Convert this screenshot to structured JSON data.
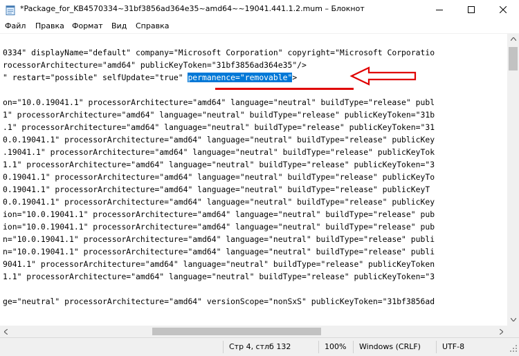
{
  "window": {
    "title": "*Package_for_KB4570334~31bf3856ad364e35~amd64~~19041.441.1.2.mum – Блокнот",
    "minimize_glyph": "—",
    "maximize_glyph": "☐",
    "close_glyph": "✕"
  },
  "menu": {
    "file": "Файл",
    "edit": "Правка",
    "format": "Формат",
    "view": "Вид",
    "help": "Справка"
  },
  "editor": {
    "lines": [
      "0334\" displayName=\"default\" company=\"Microsoft Corporation\" copyright=\"Microsoft Corporatio",
      "rocessorArchitecture=\"amd64\" publicKeyToken=\"31bf3856ad364e35\"/>",
      "",
      "",
      "on=\"10.0.19041.1\" processorArchitecture=\"amd64\" language=\"neutral\" buildType=\"release\" publ",
      "1\" processorArchitecture=\"amd64\" language=\"neutral\" buildType=\"release\" publicKeyToken=\"31b",
      ".1\" processorArchitecture=\"amd64\" language=\"neutral\" buildType=\"release\" publicKeyToken=\"31",
      "0.0.19041.1\" processorArchitecture=\"amd64\" language=\"neutral\" buildType=\"release\" publicKey",
      ".19041.1\" processorArchitecture=\"amd64\" language=\"neutral\" buildType=\"release\" publicKeyTok",
      "1.1\" processorArchitecture=\"amd64\" language=\"neutral\" buildType=\"release\" publicKeyToken=\"3",
      "0.19041.1\" processorArchitecture=\"amd64\" language=\"neutral\" buildType=\"release\" publicKeyTo",
      "0.19041.1\" processorArchitecture=\"amd64\" language=\"neutral\" buildType=\"release\" publicKeyT",
      "0.0.19041.1\" processorArchitecture=\"amd64\" language=\"neutral\" buildType=\"release\" publicKey",
      "ion=\"10.0.19041.1\" processorArchitecture=\"amd64\" language=\"neutral\" buildType=\"release\" pub",
      "ion=\"10.0.19041.1\" processorArchitecture=\"amd64\" language=\"neutral\" buildType=\"release\" pub",
      "n=\"10.0.19041.1\" processorArchitecture=\"amd64\" language=\"neutral\" buildType=\"release\" publi",
      "n=\"10.0.19041.1\" processorArchitecture=\"amd64\" language=\"neutral\" buildType=\"release\" publi",
      "9041.1\" processorArchitecture=\"amd64\" language=\"neutral\" buildType=\"release\" publicKeyToken",
      "1.1\" processorArchitecture=\"amd64\" language=\"neutral\" buildType=\"release\" publicKeyToken=\"3",
      "",
      "ge=\"neutral\" processorArchitecture=\"amd64\" versionScope=\"nonSxS\" publicKeyToken=\"31bf3856ad"
    ],
    "selected_line": {
      "before": "\" restart=\"possible\" selfUpdate=\"true\" ",
      "selection": "permanence=\"removable\"",
      "after": ">"
    }
  },
  "status": {
    "position": "Стр 4, стлб 132",
    "zoom": "100%",
    "line_endings": "Windows (CRLF)",
    "encoding": "UTF-8"
  },
  "annotation_color": "#e00000",
  "selection_color": "#0078d7"
}
